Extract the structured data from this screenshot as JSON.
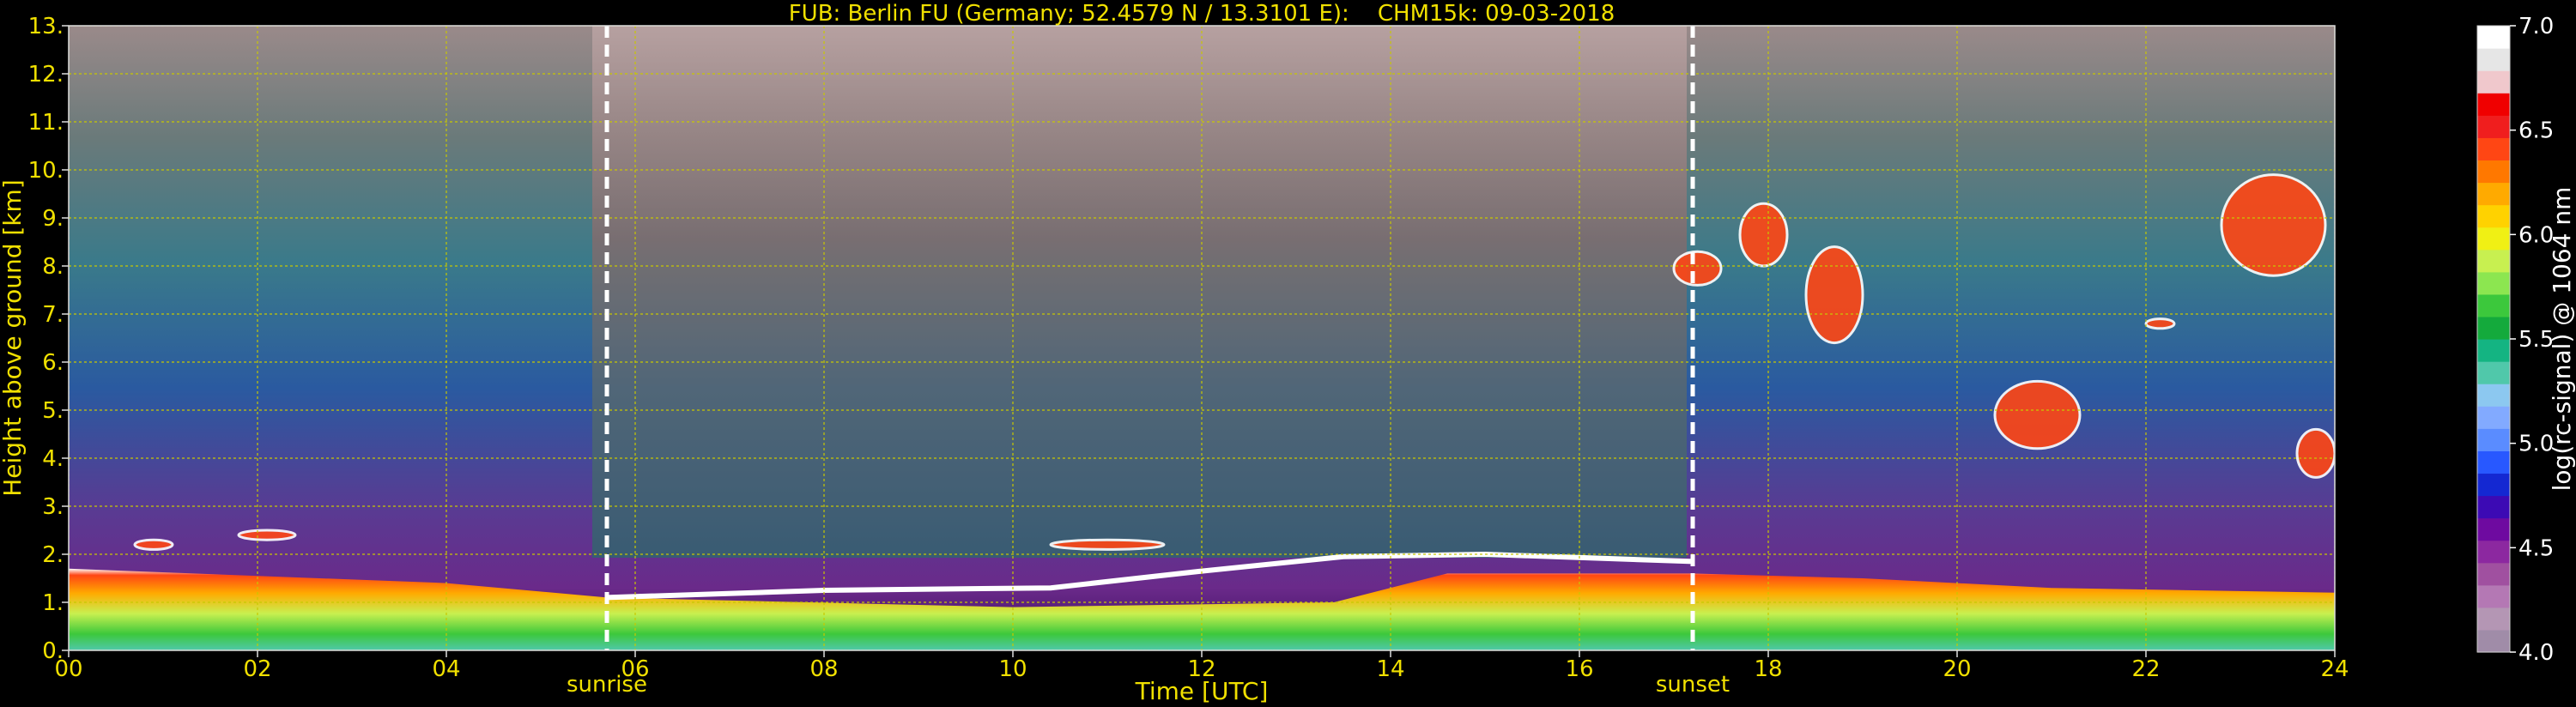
{
  "chart_data": {
    "type": "heatmap",
    "title": "FUB: Berlin FU (Germany; 52.4579 N / 13.3101 E):    CHM15k: 09-03-2018",
    "xlabel": "Time [UTC]",
    "ylabel": "Height above ground [km]",
    "xlim": [
      0,
      24
    ],
    "ylim": [
      0,
      13
    ],
    "x_ticks": [
      "00",
      "02",
      "04",
      "06",
      "08",
      "10",
      "12",
      "14",
      "16",
      "18",
      "20",
      "22",
      "24"
    ],
    "x_tick_values": [
      0,
      2,
      4,
      6,
      8,
      10,
      12,
      14,
      16,
      18,
      20,
      22,
      24
    ],
    "y_ticks": [
      "0.",
      "1.",
      "2.",
      "3.",
      "4.",
      "5.",
      "6.",
      "7.",
      "8.",
      "9.",
      "10.",
      "11.",
      "12.",
      "13."
    ],
    "y_tick_values": [
      0,
      1,
      2,
      3,
      4,
      5,
      6,
      7,
      8,
      9,
      10,
      11,
      12,
      13
    ],
    "grid": true,
    "grid_color": "#c8c800",
    "annotations": [
      {
        "name": "sunrise",
        "label": "sunrise",
        "x": 5.7
      },
      {
        "name": "sunset",
        "label": "sunset",
        "x": 17.2
      }
    ],
    "colorbar": {
      "label": "log(rc-signal) @ 1064 nm",
      "range": [
        4.0,
        7.0
      ],
      "ticks": [
        "4.0",
        "4.5",
        "5.0",
        "5.5",
        "6.0",
        "6.5",
        "7.0"
      ],
      "tick_values": [
        4.0,
        4.5,
        5.0,
        5.5,
        6.0,
        6.5,
        7.0
      ],
      "colors": [
        "#a08ca8",
        "#b496b4",
        "#b478b4",
        "#a050a0",
        "#8c28a0",
        "#6e0aa0",
        "#3c0ab4",
        "#1428d2",
        "#2858ff",
        "#5a8cff",
        "#82aaff",
        "#8cc8f0",
        "#50c8aa",
        "#14b482",
        "#14aa3c",
        "#3cc83c",
        "#8ce650",
        "#c8f050",
        "#f0f014",
        "#ffd200",
        "#ffaa00",
        "#ff7800",
        "#ff4614",
        "#f01e1e",
        "#f00000",
        "#f0c8cc",
        "#e6e6e6",
        "#ffffff"
      ]
    },
    "layers": [
      {
        "name": "boundary-layer-base",
        "x": [
          0,
          4,
          5.7,
          10,
          13.4,
          14.6,
          17.2,
          19,
          21,
          24
        ],
        "top": [
          1.7,
          1.4,
          1.1,
          0.9,
          1.0,
          1.6,
          1.6,
          1.5,
          1.3,
          1.2
        ]
      },
      {
        "name": "aerosol-layer-top",
        "x": [
          5.7,
          8,
          10.4,
          12,
          13.5,
          15,
          17.2
        ],
        "top": [
          1.1,
          1.25,
          1.3,
          1.65,
          1.95,
          2.0,
          1.85
        ]
      }
    ],
    "clouds": [
      {
        "x": [
          0.7,
          1.1
        ],
        "y": [
          2.1,
          2.3
        ]
      },
      {
        "x": [
          1.8,
          2.4
        ],
        "y": [
          2.3,
          2.5
        ]
      },
      {
        "x": [
          10.4,
          11.6
        ],
        "y": [
          2.1,
          2.3
        ]
      },
      {
        "x": [
          17.0,
          17.5
        ],
        "y": [
          7.6,
          8.3
        ]
      },
      {
        "x": [
          17.7,
          18.2
        ],
        "y": [
          8.0,
          9.3
        ]
      },
      {
        "x": [
          18.4,
          19.0
        ],
        "y": [
          6.4,
          8.4
        ]
      },
      {
        "x": [
          20.4,
          21.3
        ],
        "y": [
          4.2,
          5.6
        ]
      },
      {
        "x": [
          22.0,
          22.3
        ],
        "y": [
          6.7,
          6.9
        ]
      },
      {
        "x": [
          22.8,
          23.9
        ],
        "y": [
          7.8,
          9.9
        ]
      },
      {
        "x": [
          23.6,
          24.0
        ],
        "y": [
          3.6,
          4.6
        ]
      }
    ]
  }
}
